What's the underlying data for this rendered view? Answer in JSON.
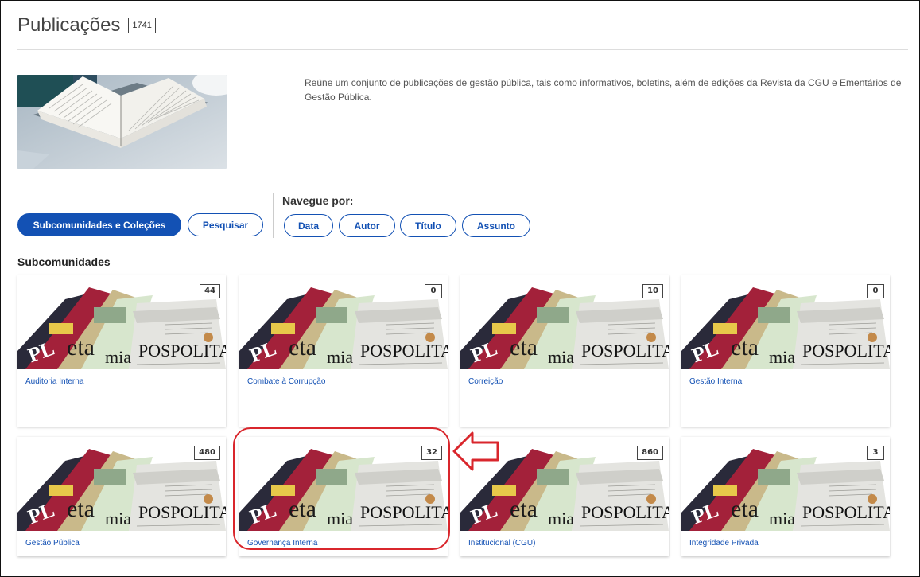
{
  "header": {
    "title": "Publicações",
    "count": "1741"
  },
  "description": "Reúne um conjunto de publicações de gestão pública, tais como informativos, boletins, além de edições da Revista da CGU e Ementários de Gestão Pública.",
  "tabs": {
    "primary": "Subcomunidades e Coleções",
    "search": "Pesquisar"
  },
  "browse": {
    "label": "Navegue por:",
    "options": [
      "Data",
      "Autor",
      "Título",
      "Assunto"
    ]
  },
  "subcommunities": {
    "title": "Subcomunidades",
    "items": [
      {
        "label": "Auditoria Interna",
        "count": "44"
      },
      {
        "label": "Combate à Corrupção",
        "count": "0"
      },
      {
        "label": "Correição",
        "count": "10"
      },
      {
        "label": "Gestão Interna",
        "count": "0"
      },
      {
        "label": "Gestão Pública",
        "count": "480"
      },
      {
        "label": "Governança Interna",
        "count": "32"
      },
      {
        "label": "Institucional (CGU)",
        "count": "860"
      },
      {
        "label": "Integridade Privada",
        "count": "3"
      }
    ]
  },
  "colors": {
    "primary": "#1351b4",
    "highlight": "#d9262c"
  }
}
